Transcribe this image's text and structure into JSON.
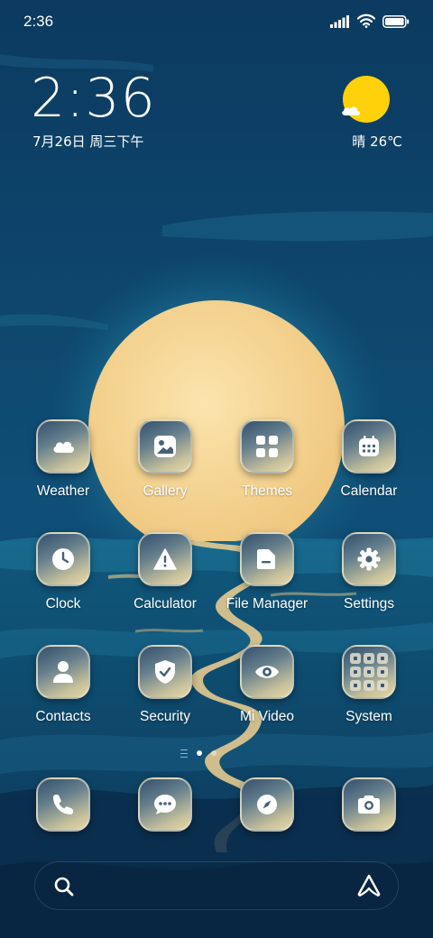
{
  "status_bar": {
    "time": "2:36",
    "signal_icon": "signal-bars-icon",
    "wifi_icon": "wifi-icon",
    "battery_icon": "battery-icon"
  },
  "clock_widget": {
    "time": "2:36",
    "date": "7月26日 周三下午"
  },
  "weather_widget": {
    "icon": "sun-cloud-icon",
    "text": "晴 26℃"
  },
  "apps": [
    {
      "label": "Weather",
      "icon": "weather-cloud-icon"
    },
    {
      "label": "Gallery",
      "icon": "gallery-image-icon"
    },
    {
      "label": "Themes",
      "icon": "themes-grid-icon"
    },
    {
      "label": "Calendar",
      "icon": "calendar-icon"
    },
    {
      "label": "Clock",
      "icon": "clock-icon"
    },
    {
      "label": "Calculator",
      "icon": "warning-triangle-icon"
    },
    {
      "label": "File Manager",
      "icon": "folder-icon"
    },
    {
      "label": "Settings",
      "icon": "gear-icon"
    },
    {
      "label": "Contacts",
      "icon": "person-icon"
    },
    {
      "label": "Security",
      "icon": "shield-check-icon"
    },
    {
      "label": "Mi Video",
      "icon": "eye-icon"
    },
    {
      "label": "System",
      "icon": "app-folder-grid-icon"
    }
  ],
  "page_indicator": {
    "pages": 2,
    "current": 1
  },
  "dock": [
    {
      "icon": "phone-icon"
    },
    {
      "icon": "message-bubble-icon"
    },
    {
      "icon": "compass-icon"
    },
    {
      "icon": "camera-icon"
    }
  ],
  "search_bar": {
    "left_icon": "search-icon",
    "right_icon": "assistant-a-icon"
  },
  "colors": {
    "sky": "#0d3a5e",
    "moon": "#f4d597",
    "weather_sun": "#ffd10a"
  }
}
